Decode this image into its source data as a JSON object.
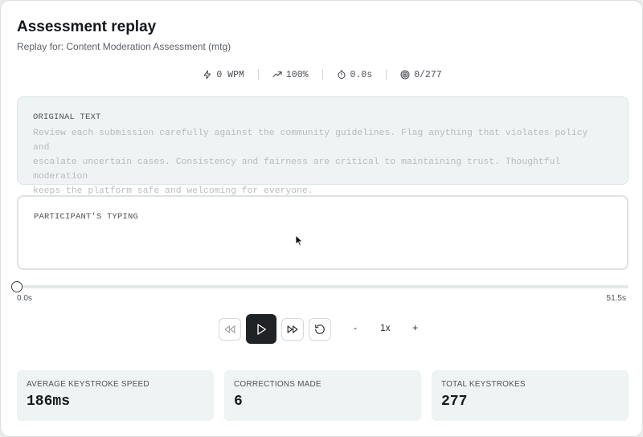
{
  "header": {
    "title": "Assessment replay",
    "subtitle": "Replay for: Content Moderation Assessment (mtg)"
  },
  "stats": {
    "wpm": "0 WPM",
    "accuracy": "100%",
    "elapsed": "0.0s",
    "progress": "0/277"
  },
  "original": {
    "label": "ORIGINAL TEXT",
    "lines": [
      "Review each submission carefully against the community guidelines. Flag anything that violates policy and",
      "escalate uncertain cases. Consistency and fairness are critical to maintaining trust. Thoughtful moderation",
      "keeps the platform safe and welcoming for everyone."
    ]
  },
  "typing": {
    "label": "PARTICIPANT'S TYPING",
    "value": ""
  },
  "timeline": {
    "start": "0.0s",
    "end": "51.5s",
    "position_fraction": 0
  },
  "controls": {
    "speed": "1x",
    "decrease": "-",
    "increase": "+",
    "icons": [
      "rewind-icon",
      "play-icon",
      "fast-forward-icon",
      "restart-icon"
    ]
  },
  "metrics": [
    {
      "label": "AVERAGE KEYSTROKE SPEED",
      "value": "186ms"
    },
    {
      "label": "CORRECTIONS MADE",
      "value": "6"
    },
    {
      "label": "TOTAL KEYSTROKES",
      "value": "277"
    }
  ],
  "colors": {
    "panel_bg": "#eef3f3",
    "play_button": "#202326",
    "muted_text": "#b7bdbf"
  }
}
